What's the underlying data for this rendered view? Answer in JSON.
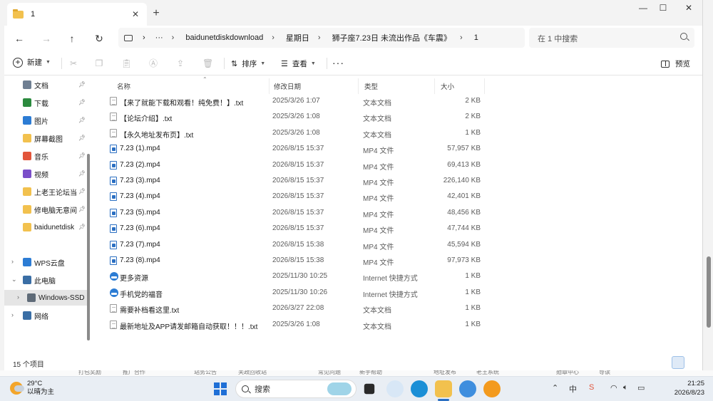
{
  "window": {
    "tab_title": "1",
    "tab_close": "✕",
    "new_tab": "+",
    "minimize": "—",
    "maximize": "☐",
    "close": "✕"
  },
  "nav": {
    "back": "←",
    "forward": "→",
    "up": "↑",
    "refresh": "↻",
    "breadcrumb": [
      "···",
      "baidunetdiskdownload",
      "星期日",
      "狮子座7.23日 未流出作品《车震》",
      "1"
    ],
    "search_placeholder": "在 1 中搜索"
  },
  "toolbar": {
    "new_label": "新建",
    "sort_label": "排序",
    "view_label": "查看",
    "more_label": "···",
    "preview_label": "预览"
  },
  "sidebar": {
    "items": [
      {
        "label": "文档",
        "icon": "document-icon",
        "color": "#6f7f92",
        "pinned": true
      },
      {
        "label": "下载",
        "icon": "download-icon",
        "color": "#2b8a3e",
        "pinned": true
      },
      {
        "label": "图片",
        "icon": "pictures-icon",
        "color": "#2c7cd4",
        "pinned": true
      },
      {
        "label": "屏幕截图",
        "icon": "folder-icon",
        "color": "#f2c14e",
        "pinned": true
      },
      {
        "label": "音乐",
        "icon": "music-icon",
        "color": "#e2553b",
        "pinned": true
      },
      {
        "label": "视频",
        "icon": "video-icon",
        "color": "#7b4fc9",
        "pinned": true
      },
      {
        "label": "上老王论坛当",
        "icon": "folder-icon",
        "color": "#f2c14e",
        "pinned": true
      },
      {
        "label": "修电脑无意间",
        "icon": "folder-icon",
        "color": "#f2c14e",
        "pinned": true
      },
      {
        "label": "baidunetdisk",
        "icon": "folder-icon",
        "color": "#f2c14e",
        "pinned": true
      }
    ],
    "tree": [
      {
        "label": "WPS云盘",
        "icon": "cloud-icon",
        "color": "#2c7cd4",
        "expand": "›"
      },
      {
        "label": "此电脑",
        "icon": "computer-icon",
        "color": "#3a6ea5",
        "expand": "⌄"
      },
      {
        "label": "Windows-SSD",
        "icon": "drive-icon",
        "color": "#5f6b78",
        "expand": "›"
      },
      {
        "label": "网络",
        "icon": "network-icon",
        "color": "#3a6ea5",
        "expand": "›"
      }
    ]
  },
  "columns": {
    "name": "名称",
    "date": "修改日期",
    "type": "类型",
    "size": "大小"
  },
  "files": [
    {
      "name": "【来了就能下载和观看！纯免费！】.txt",
      "date": "2025/3/26 1:07",
      "type": "文本文档",
      "size": "2 KB",
      "kind": "txt"
    },
    {
      "name": "【论坛介绍】.txt",
      "date": "2025/3/26 1:08",
      "type": "文本文档",
      "size": "2 KB",
      "kind": "txt"
    },
    {
      "name": "【永久地址发布页】.txt",
      "date": "2025/3/26 1:08",
      "type": "文本文档",
      "size": "1 KB",
      "kind": "txt"
    },
    {
      "name": "7.23 (1).mp4",
      "date": "2026/8/15 15:37",
      "type": "MP4 文件",
      "size": "57,957 KB",
      "kind": "mp4"
    },
    {
      "name": "7.23 (2).mp4",
      "date": "2026/8/15 15:37",
      "type": "MP4 文件",
      "size": "69,413 KB",
      "kind": "mp4"
    },
    {
      "name": "7.23 (3).mp4",
      "date": "2026/8/15 15:37",
      "type": "MP4 文件",
      "size": "226,140 KB",
      "kind": "mp4"
    },
    {
      "name": "7.23 (4).mp4",
      "date": "2026/8/15 15:37",
      "type": "MP4 文件",
      "size": "42,401 KB",
      "kind": "mp4"
    },
    {
      "name": "7.23 (5).mp4",
      "date": "2026/8/15 15:37",
      "type": "MP4 文件",
      "size": "48,456 KB",
      "kind": "mp4"
    },
    {
      "name": "7.23 (6).mp4",
      "date": "2026/8/15 15:37",
      "type": "MP4 文件",
      "size": "47,744 KB",
      "kind": "mp4"
    },
    {
      "name": "7.23 (7).mp4",
      "date": "2026/8/15 15:38",
      "type": "MP4 文件",
      "size": "45,594 KB",
      "kind": "mp4"
    },
    {
      "name": "7.23 (8).mp4",
      "date": "2026/8/15 15:38",
      "type": "MP4 文件",
      "size": "97,973 KB",
      "kind": "mp4"
    },
    {
      "name": "更多资源",
      "date": "2025/11/30 10:25",
      "type": "Internet 快捷方式",
      "size": "1 KB",
      "kind": "url"
    },
    {
      "name": "手机党的福音",
      "date": "2025/11/30 10:26",
      "type": "Internet 快捷方式",
      "size": "1 KB",
      "kind": "url"
    },
    {
      "name": "需要补档看这里.txt",
      "date": "2026/3/27 22:08",
      "type": "文本文档",
      "size": "1 KB",
      "kind": "txt"
    },
    {
      "name": "最新地址及APP请发邮箱自动获取！！！.txt",
      "date": "2025/3/26 1:08",
      "type": "文本文档",
      "size": "1 KB",
      "kind": "txt"
    }
  ],
  "status": {
    "count": "15 个项目"
  },
  "background_text": [
    "打包奖励",
    "推广合作",
    "站务公告",
    "关政回收站",
    "常见问题",
    "新手帮助",
    "地址发布",
    "老王系统",
    "勋章中心",
    "导读"
  ],
  "taskbar": {
    "temp": "29°C",
    "weather": "以晴为主",
    "search": "搜索",
    "time": "21:25",
    "date": "2026/8/23",
    "ime": "中",
    "accent": "#2b6fc2"
  }
}
